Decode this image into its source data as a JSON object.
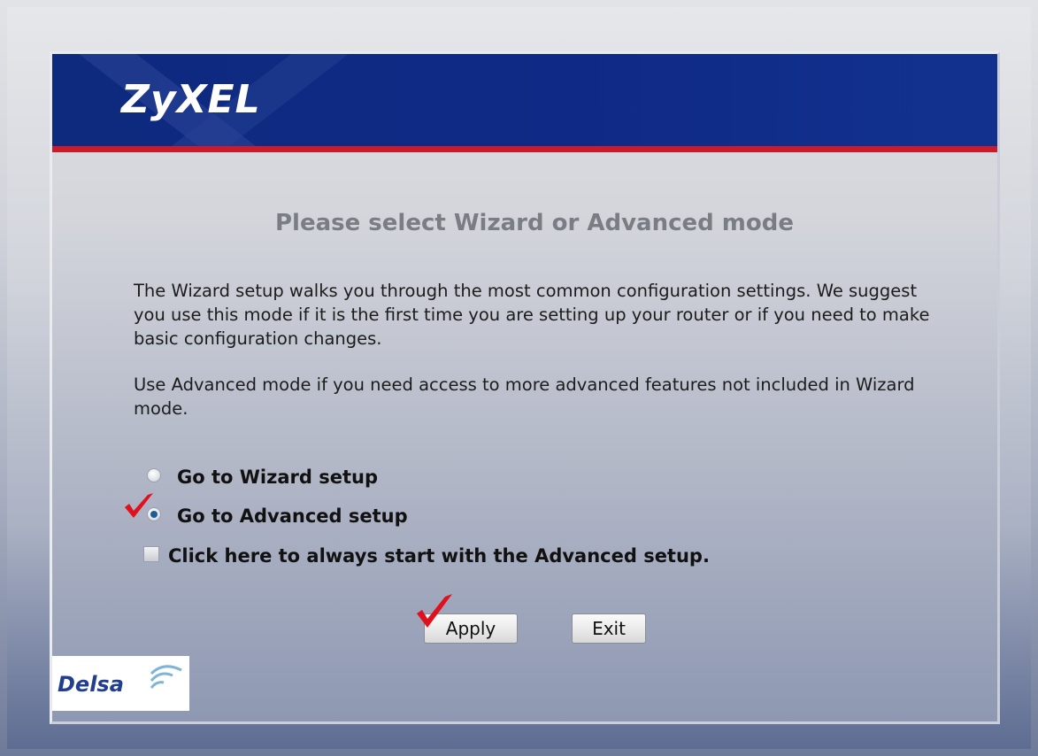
{
  "brand": {
    "logo_text": "ZyXEL",
    "accent_color": "#0f2a86",
    "stripe_color": "#c81c2c"
  },
  "page": {
    "heading": "Please select Wizard or Advanced mode",
    "paragraph1": "The Wizard setup walks you through the most common configuration settings. We suggest you use this mode if it is the first time you are setting up your router or if you need to make basic configuration changes.",
    "paragraph2": "Use Advanced mode if you need access to more advanced features not included in Wizard mode."
  },
  "options": {
    "wizard": {
      "label": "Go to Wizard setup",
      "selected": false
    },
    "advanced": {
      "label": "Go to Advanced setup",
      "selected": true
    },
    "always_advanced": {
      "label": "Click here to always start with the Advanced setup.",
      "checked": false
    }
  },
  "buttons": {
    "apply": "Apply",
    "exit": "Exit"
  },
  "annotations": {
    "mark_color": "#e0101c",
    "mark_icon": "check-mark-icon"
  },
  "footer": {
    "partner_logo_text": "Delsa"
  }
}
